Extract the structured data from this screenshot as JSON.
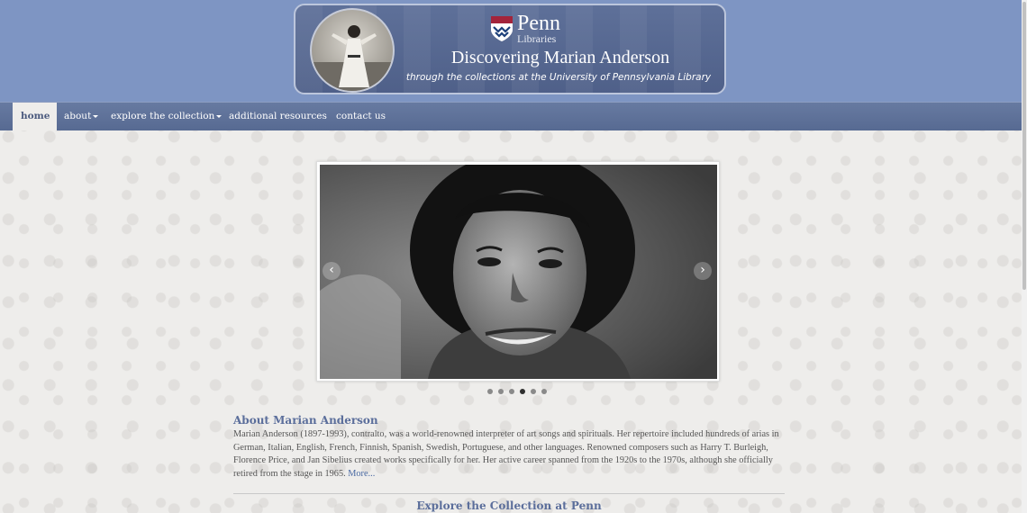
{
  "banner": {
    "logo_word": "Penn",
    "logo_sub": "Libraries",
    "title": "Discovering Marian Anderson",
    "subtitle": "through the collections at the University of Pennsylvania Library"
  },
  "nav": {
    "items": [
      {
        "label": "home",
        "active": true
      },
      {
        "label": "about",
        "dropdown": true
      },
      {
        "label": "explore the collection",
        "dropdown": true
      },
      {
        "label": "additional resources"
      },
      {
        "label": "contact us"
      }
    ]
  },
  "carousel": {
    "prev_icon": "‹",
    "next_icon": "›",
    "slide_count": 6,
    "active_index": 3
  },
  "about": {
    "heading": "About Marian Anderson",
    "body": "Marian Anderson (1897-1993), contralto, was a world-renowned interpreter of art songs and spirituals. Her repertoire included hundreds of arias in German, Italian, English, French, Finnish, Spanish, Swedish, Portuguese, and other languages. Renowned composers such as Harry T. Burleigh, Florence Price, and Jan Sibelius created works specifically for her. Her active career spanned from the 1920s to the 1970s, although she officially retired from the stage in 1965.",
    "more_link": "More..."
  },
  "explore": {
    "heading": "Explore the Collection at Penn"
  },
  "colors": {
    "header_bg": "#7e95c3",
    "nav_bg": "#5f729a",
    "heading": "#5b6e9b",
    "link": "#4a6aa3"
  }
}
